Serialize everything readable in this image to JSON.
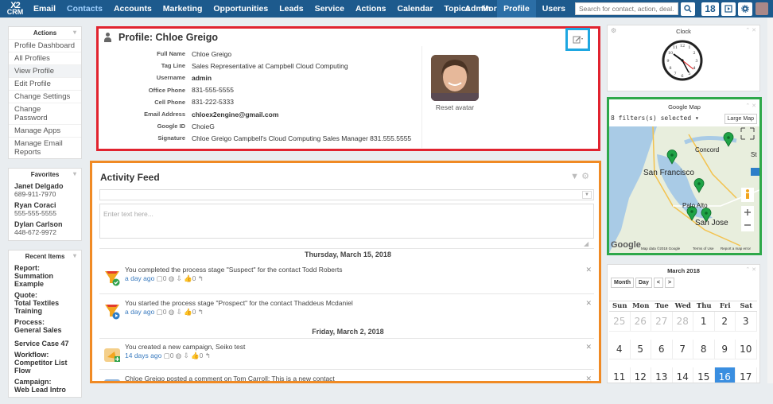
{
  "topbar": {
    "logo_top": "X2",
    "logo_bottom": "CRM",
    "nav": [
      "Email",
      "Contacts",
      "Accounts",
      "Marketing",
      "Opportunities",
      "Leads",
      "Service",
      "Actions",
      "Calendar",
      "Topics",
      "More ▾"
    ],
    "right_links": [
      "Admin",
      "Profile",
      "Users"
    ],
    "search_placeholder": "Search for contact, action, deal...",
    "notifications": "18"
  },
  "actions_panel": {
    "title": "Actions",
    "items": [
      "Profile Dashboard",
      "All Profiles",
      "View Profile",
      "Edit Profile",
      "Change Settings",
      "Change Password",
      "Manage Apps",
      "Manage Email Reports"
    ]
  },
  "favorites_panel": {
    "title": "Favorites",
    "items": [
      {
        "name": "Janet Delgado",
        "phone": "689-911-7970"
      },
      {
        "name": "Ryan Coraci",
        "phone": "555-555-5555"
      },
      {
        "name": "Dylan Carlson",
        "phone": "448-672-9972"
      }
    ]
  },
  "recent_panel": {
    "title": "Recent Items",
    "items": [
      {
        "type": "Report:",
        "name": "Summation Example"
      },
      {
        "type": "Quote:",
        "name": "Total Textiles Training"
      },
      {
        "type": "Process:",
        "name": "General Sales"
      },
      {
        "type": "Service Case 47",
        "name": ""
      },
      {
        "type": "Workflow:",
        "name": "Competitor List Flow"
      },
      {
        "type": "Campaign:",
        "name": "Web Lead Intro"
      }
    ]
  },
  "profile": {
    "title": "Profile: Chloe Greigo",
    "fields": [
      {
        "label": "Full Name",
        "value": "Chloe Greigo"
      },
      {
        "label": "Tag Line",
        "value": "Sales Representative at Campbell Cloud Computing"
      },
      {
        "label": "Username",
        "value": "admin"
      },
      {
        "label": "Office Phone",
        "value": "831-555-5555"
      },
      {
        "label": "Cell Phone",
        "value": "831-222-5333"
      },
      {
        "label": "Email Address",
        "value": "chloex2engine@gmail.com"
      },
      {
        "label": "Google ID",
        "value": "ChoieG"
      },
      {
        "label": "Signature",
        "value": "Chloe Greigo Campbell's Cloud Computing Sales Manager 831.555.5555"
      }
    ],
    "reset_avatar": "Reset avatar"
  },
  "feed": {
    "title": "Activity Feed",
    "placeholder": "Enter text here...",
    "days": [
      "Thursday, March 15, 2018",
      "Friday, March 2, 2018"
    ],
    "activities": [
      {
        "text": "You completed the process stage \"Suspect\" for the contact Todd Roberts",
        "ago": "a day ago",
        "meta": "  ▢0  ◍  ⇩  👍0  ↰"
      },
      {
        "text": "You started the process stage \"Prospect\" for the contact Thaddeus Mcdaniel",
        "ago": "a day ago",
        "meta": "  ▢0  ◍  ⇩  👍0  ↰"
      },
      {
        "text": "You created a new campaign, Seiko test",
        "ago": "14 days ago",
        "meta": "  ▢0  ◍  ⇩  👍0  ↰"
      },
      {
        "text": "Chloe Greigo posted a comment on Tom Carroll: This is a new contact",
        "ago": "",
        "meta": ""
      }
    ]
  },
  "clock": {
    "title": "Clock"
  },
  "map": {
    "title": "Google Map",
    "filters": "8 filters(s) selected ▾",
    "large_map": "Large Map",
    "labels": [
      "Concord",
      "San Francisco",
      "Palo Alto",
      "San Jose",
      "Google",
      "Map data ©2018 Google",
      "Terms of Use",
      "Report a map error",
      "St"
    ]
  },
  "calendar": {
    "title": "March 2018",
    "buttons": [
      "Month",
      "Day",
      "<",
      ">"
    ],
    "weekdays": [
      "Sun",
      "Mon",
      "Tue",
      "Wed",
      "Thu",
      "Fri",
      "Sat"
    ],
    "weeks": [
      [
        "25",
        "26",
        "27",
        "28",
        "1",
        "2",
        "3"
      ],
      [
        "4",
        "5",
        "6",
        "7",
        "8",
        "9",
        "10"
      ],
      [
        "11",
        "12",
        "13",
        "14",
        "15",
        "16",
        "17"
      ]
    ],
    "today": "16"
  }
}
